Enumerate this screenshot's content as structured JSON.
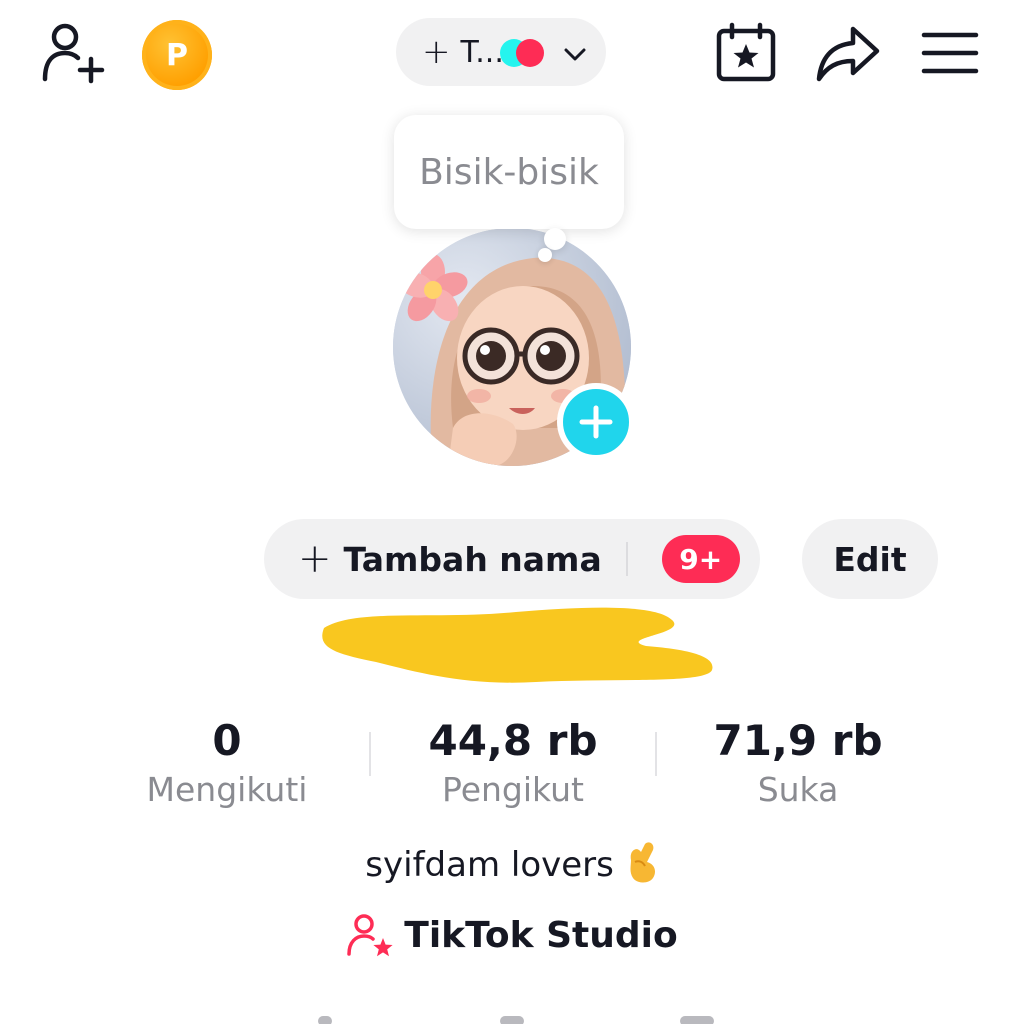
{
  "top_bar": {
    "coin_letter": "P",
    "account_switcher": {
      "plus": "+",
      "name": "T..."
    }
  },
  "bubble": {
    "text": "Bisik-bisik"
  },
  "profile": {
    "add_name_plus": "+",
    "add_name_label": "Tambah nama",
    "notification_badge": "9+",
    "edit_label": "Edit"
  },
  "stats": [
    {
      "value": "0",
      "label": "Mengikuti"
    },
    {
      "value": "44,8 rb",
      "label": "Pengikut"
    },
    {
      "value": "71,9 rb",
      "label": "Suka"
    }
  ],
  "bio": {
    "text": "syifdam lovers"
  },
  "studio": {
    "label": "TikTok Studio"
  },
  "colors": {
    "accent_red": "#fe2c55",
    "accent_cyan": "#25f4ee",
    "plus_blue": "#20d5ec",
    "coin_orange": "#ff9f00",
    "redaction_yellow": "#f9c71f"
  }
}
